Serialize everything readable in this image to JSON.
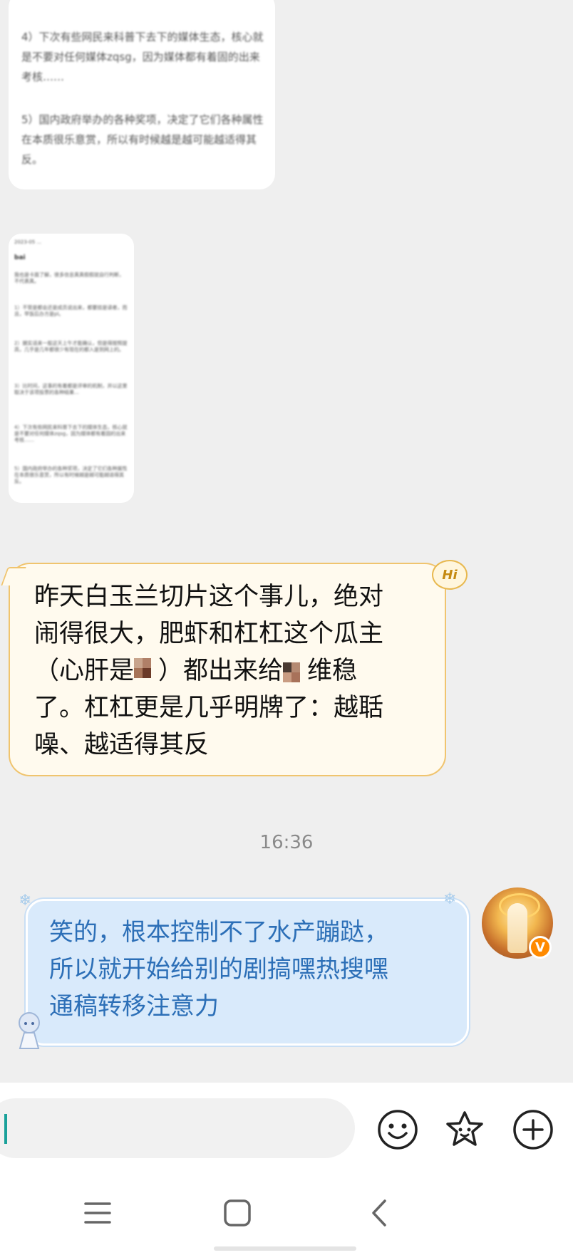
{
  "top_image": {
    "paragraphs": [
      "4）下次有些网民来科普下去下的媒体生态，核心就是不要对任何媒体zqsg，因为媒体都有着固的出来考核……",
      "5）国内政府举办的各种奖项，决定了它们各种属性在本质很乐意赏，所以有时候越是越可能越适得其反。"
    ]
  },
  "small_image": {
    "header": "bai",
    "lines": [
      "2023-05 ...",
      "bai",
      "我也是卡面了解，很多信息真真假假就自行判断，不代表真。",
      "1）不管是都会还是成员说出来，都要挂是读者，而且，早饭后办方是pl。",
      "2）据实话来一般这天上午才能确认，但是得按照提高，几乎是几年都很少有现在的都入是到网上的。",
      "3）比时间，这事的有着都是评审的机制，并以这里取决于该项投票的各种结果...",
      "4）下次有些网民来科普下去下的媒体生态，核心就是不要对任何媒体zqsg，因为媒体都有着固的出来考核……",
      "5）国内政府举办的各种奖项，决定了它们各种属性在本质很乐意赏，所以有时候越是越可能越适得其反。"
    ]
  },
  "received_message": {
    "line1": "昨天白玉兰切片这个事儿，绝对",
    "line2": "闹得很大，肥虾和杠杠这个瓜主",
    "line3a": "（心肝是",
    "line3b": "）都出来给",
    "line3c": "维稳",
    "line4": "了。杠杠更是几乎明牌了：越聒",
    "line5": "噪、越适得其反",
    "badge": "Hi"
  },
  "timestamp": "16:36",
  "sent_message": {
    "line1": "笑的，根本控制不了水产蹦跶，",
    "line2": "所以就开始给别的剧搞嘿热搜嘿",
    "line3": "通稿转移注意力",
    "vip_badge": "V"
  },
  "input": {
    "value": "",
    "icons": [
      "emoji-icon",
      "sticker-icon",
      "add-icon"
    ]
  },
  "nav": {
    "icons": [
      "menu-icon",
      "home-icon",
      "back-icon"
    ]
  },
  "colors": {
    "received_bubble_bg": "#fffaee",
    "received_bubble_border": "#f0c46e",
    "sent_bubble_bg": "#d9eafb",
    "sent_text": "#2c6fb7",
    "caret": "#1aa19a"
  }
}
